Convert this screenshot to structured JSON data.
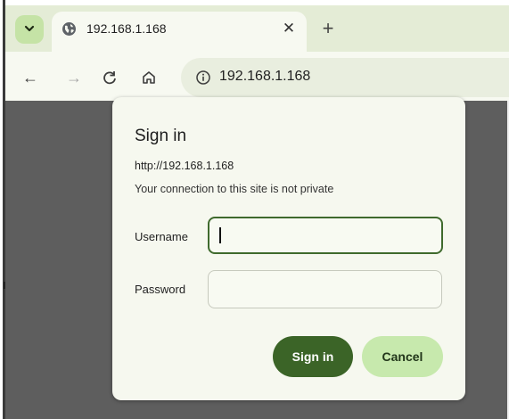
{
  "browser": {
    "tab": {
      "title": "192.168.1.168",
      "favicon": "globe-icon",
      "close_glyph": "✕"
    },
    "tab_search_glyph": "⌄",
    "new_tab_glyph": "+",
    "toolbar": {
      "back_glyph": "←",
      "forward_glyph": "→",
      "reload_glyph": "C",
      "home_glyph": "⌂"
    },
    "omnibox": {
      "security_icon": "info-icon",
      "url": "192.168.1.168"
    }
  },
  "dialog": {
    "title": "Sign in",
    "origin": "http://192.168.1.168",
    "warning": "Your connection to this site is not private",
    "username_label": "Username",
    "username_value": "",
    "password_label": "Password",
    "password_value": "",
    "signin_label": "Sign in",
    "cancel_label": "Cancel"
  },
  "colors": {
    "accent": "#3b6427",
    "accent_light": "#c7e9ad",
    "tabstrip": "#e4ecd6",
    "page_backdrop": "#5e5e5e"
  }
}
